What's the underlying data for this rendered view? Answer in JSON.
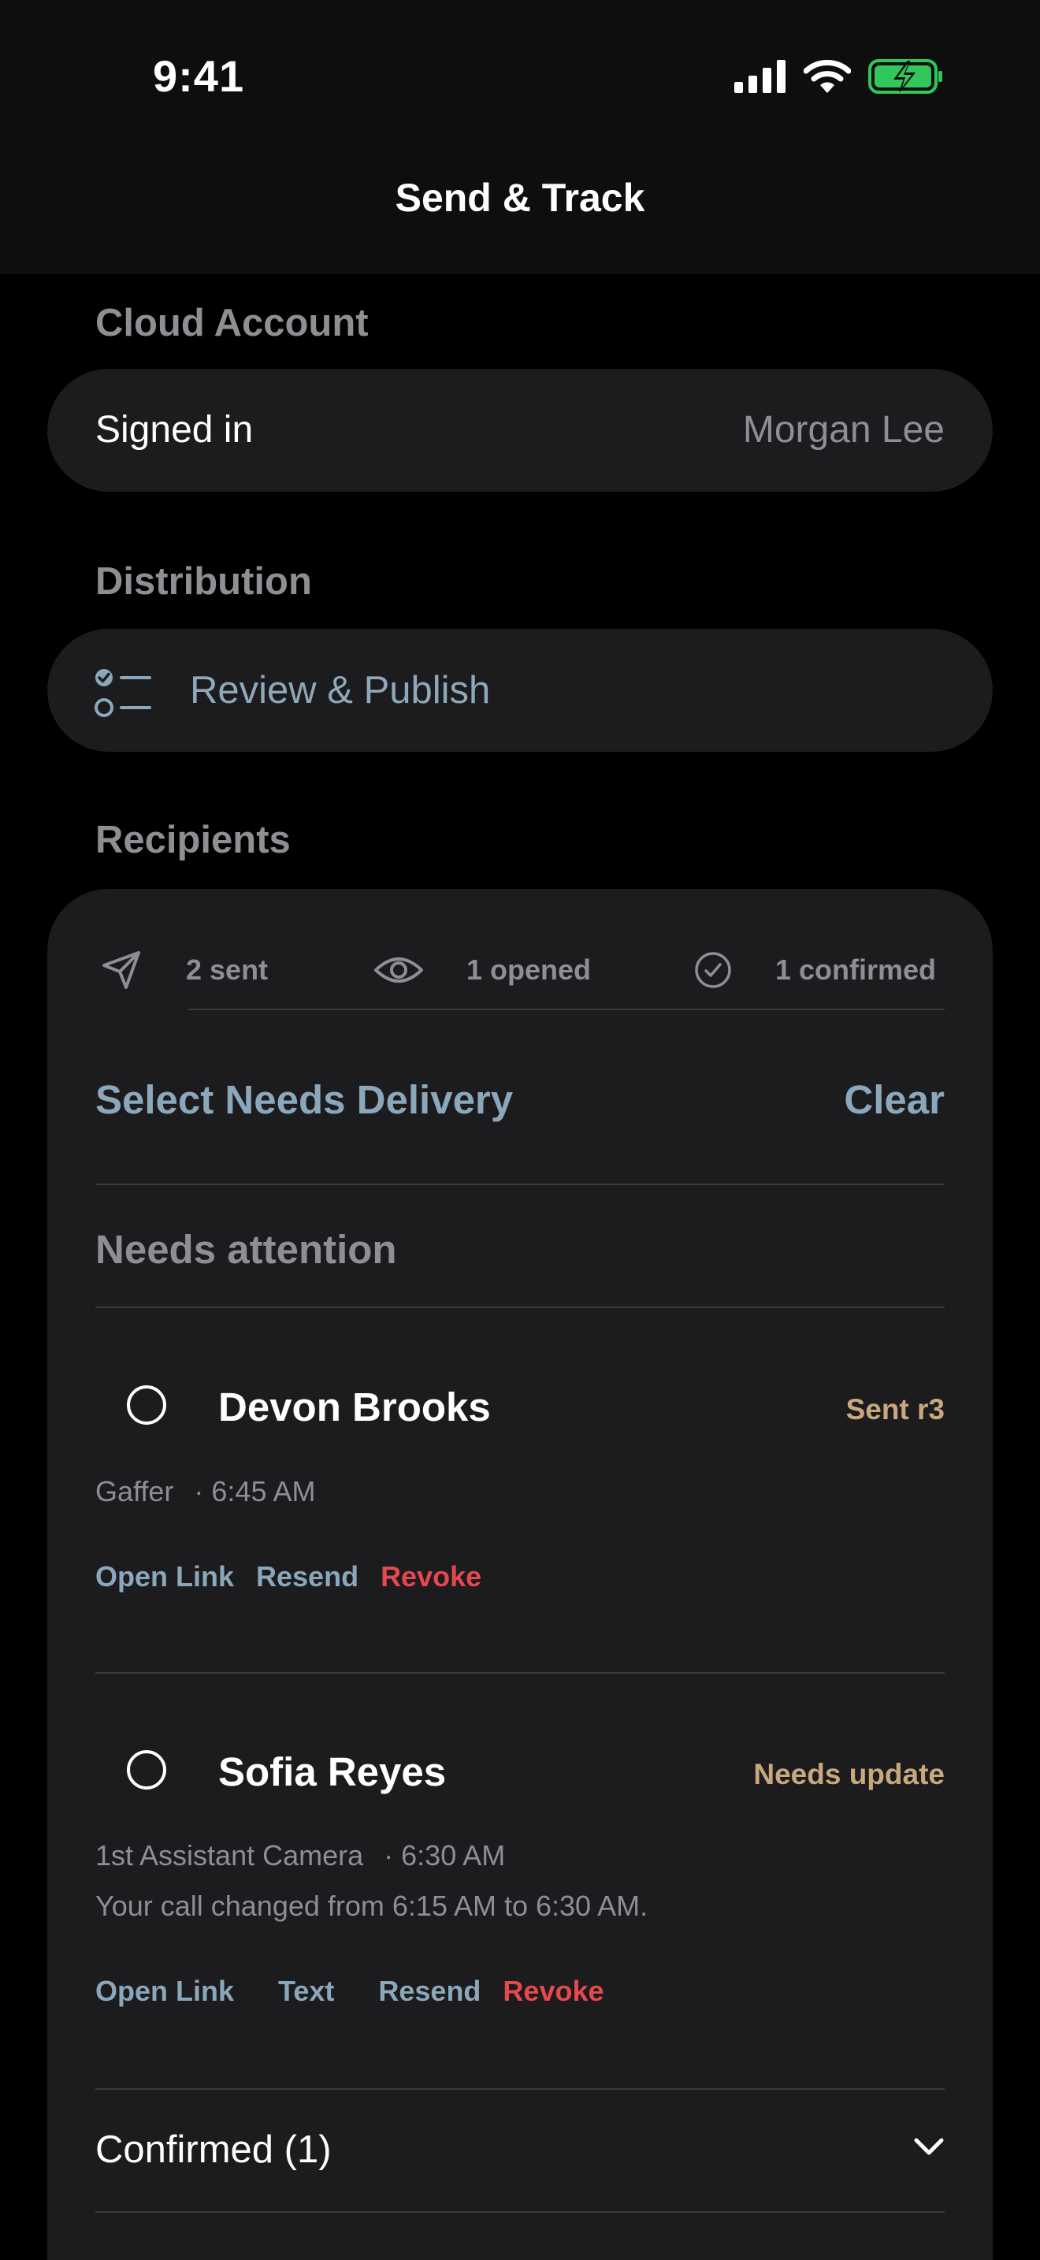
{
  "status_bar": {
    "time": "9:41"
  },
  "nav": {
    "title": "Send & Track"
  },
  "cloud_account": {
    "section_label": "Cloud Account",
    "signed_in_label": "Signed in",
    "user_name": "Morgan Lee"
  },
  "distribution": {
    "section_label": "Distribution",
    "action_label": "Review & Publish"
  },
  "recipients": {
    "section_label": "Recipients",
    "stats": {
      "sent": "2 sent",
      "opened": "1 opened",
      "confirmed": "1 confirmed"
    },
    "select_needs_delivery": "Select Needs Delivery",
    "clear": "Clear",
    "needs_attention_label": "Needs attention",
    "items": [
      {
        "name": "Devon Brooks",
        "status": "Sent r3",
        "role": "Gaffer",
        "time": "· 6:45 AM",
        "actions": {
          "open_link": "Open Link",
          "resend": "Resend",
          "revoke": "Revoke"
        }
      },
      {
        "name": "Sofia Reyes",
        "status": "Needs update",
        "role": "1st Assistant Camera",
        "time": "· 6:30 AM",
        "note": "Your call changed from 6:15 AM to 6:30 AM.",
        "actions": {
          "open_link": "Open Link",
          "text": "Text",
          "resend": "Resend",
          "revoke": "Revoke"
        }
      }
    ],
    "confirmed_label": "Confirmed (1)"
  },
  "colors": {
    "background": "#000000",
    "card": "#1c1c1e",
    "accent_blue": "#8aa7bb",
    "status_gold": "#c8a97e",
    "revoke_red": "#e5484d",
    "battery_green": "#32c75a"
  },
  "icons": [
    "signal-icon",
    "wifi-icon",
    "battery-charging-icon",
    "checklist-icon",
    "send-icon",
    "eye-icon",
    "check-circle-icon",
    "chevron-down-icon"
  ]
}
